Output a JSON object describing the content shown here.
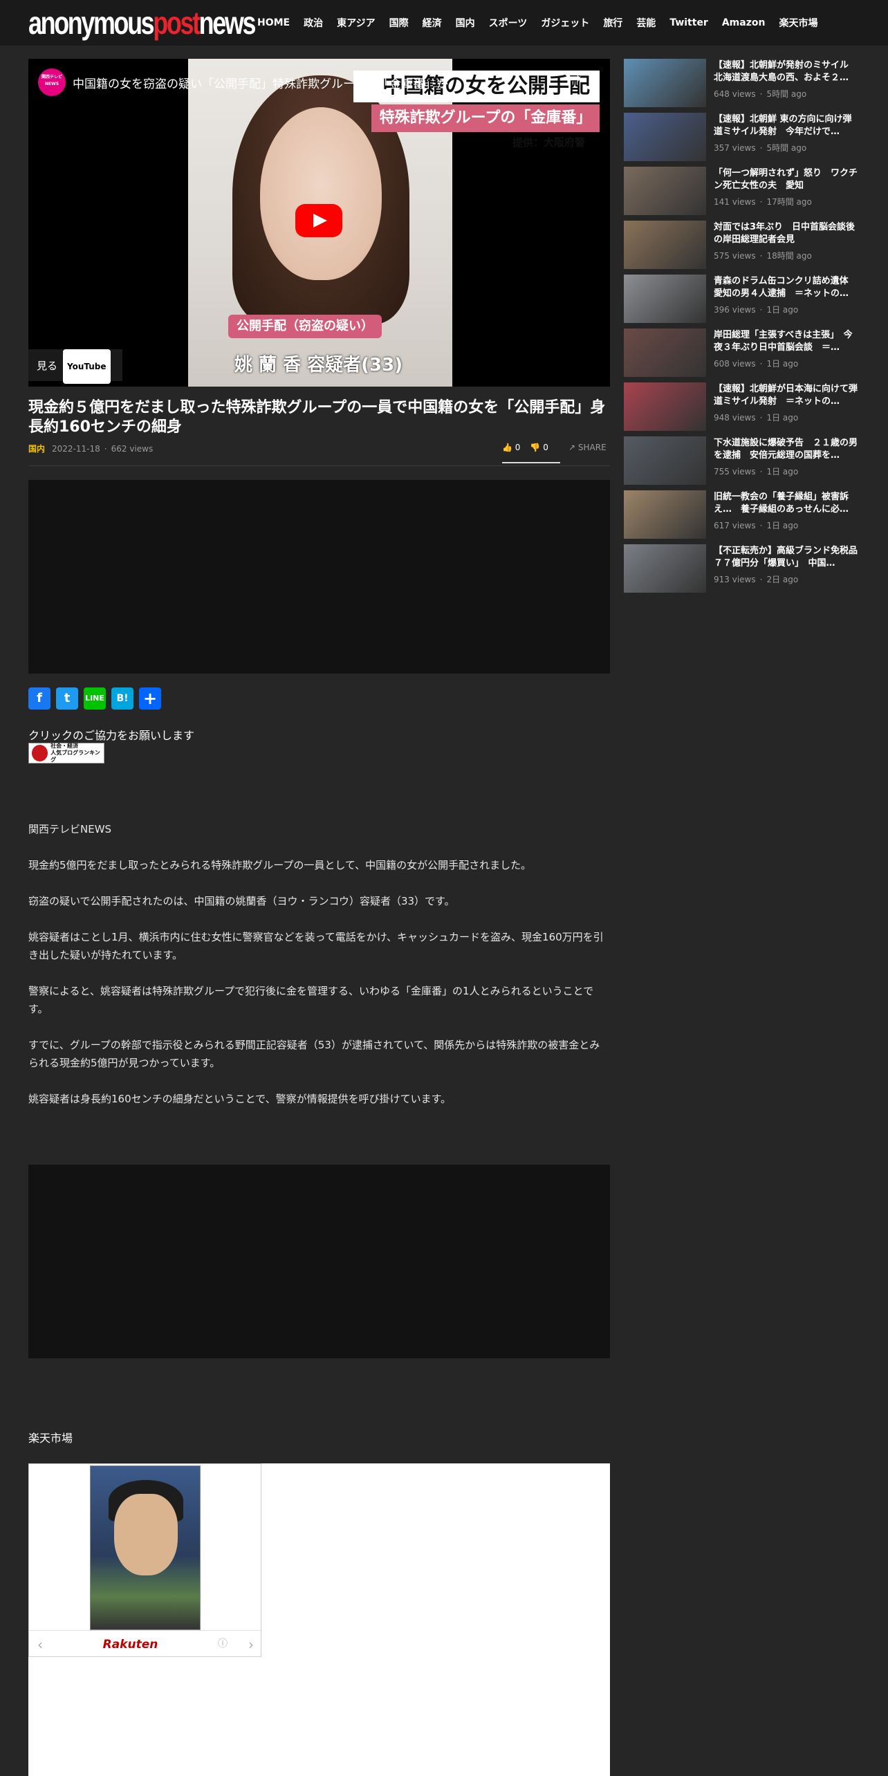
{
  "header": {
    "logo_anonymous": "anonymous",
    "logo_post": "post",
    "logo_news": "news",
    "nav": [
      "HOME",
      "政治",
      "東アジア",
      "国際",
      "経済",
      "国内",
      "スポーツ",
      "ガジェット",
      "旅行",
      "芸能",
      "Twitter",
      "Amazon",
      "楽天市場"
    ]
  },
  "video": {
    "channel_logo": "関西テレビ NEWS",
    "title": "中国籍の女を窃盗の疑い「公開手配」特殊詐欺グループの「金庫番」か",
    "banner_main": "中国籍の女を公開手配",
    "banner_sub": "特殊詐欺グループの「金庫番」",
    "credit": "提供：大阪府警",
    "caption_tag": "公開手配（窃盗の疑い）",
    "caption_name": "姚 蘭 香 容疑者(33)",
    "watch_label": "見る",
    "youtube_label": "YouTube",
    "play_icon": "youtube-play-icon",
    "share_icon": "share-arrow-icon"
  },
  "article": {
    "title": "現金約５億円をだまし取った特殊詐欺グループの一員で中国籍の女を「公開手配」身長約160センチの細身",
    "category": "国内",
    "date": "2022-11-18",
    "views": "662 views",
    "likes": "0",
    "dislikes": "0",
    "share_label": "SHARE",
    "click_text": "クリックのご協力をお願いします",
    "blog_rank_line1": "社会・経済",
    "blog_rank_line2": "人気ブログランキング",
    "paragraphs": [
      "関西テレビNEWS",
      "現金約5億円をだまし取ったとみられる特殊詐欺グループの一員として、中国籍の女が公開手配されました。",
      "窃盗の疑いで公開手配されたのは、中国籍の姚蘭香（ヨウ・ランコウ）容疑者（33）です。",
      "姚容疑者はことし1月、横浜市内に住む女性に警察官などを装って電話をかけ、キャッシュカードを盗み、現金160万円を引き出した疑いが持たれています。",
      "警察によると、姚容疑者は特殊詐欺グループで犯行後に金を管理する、いわゆる「金庫番」の1人とみられるということです。",
      "すでに、グループの幹部で指示役とみられる野間正記容疑者（53）が逮捕されていて、関係先からは特殊詐欺の被害金とみられる現金約5億円が見つかっています。",
      "姚容疑者は身長約160センチの細身だということで、警察が情報提供を呼び掛けています。"
    ],
    "rakuten_heading": "楽天市場",
    "rakuten_logo": "Rakuten"
  },
  "social": [
    "facebook-icon",
    "twitter-icon",
    "line-icon",
    "hatena-icon",
    "addtoany-icon"
  ],
  "sidebar": [
    {
      "title": "【速報】北朝鮮が発射のミサイル　北海道渡島大島の西、およそ２…",
      "views": "648 views",
      "ago": "5時間 ago",
      "thumb": "#5f8fb3"
    },
    {
      "title": "【速報】北朝鮮 東の方向に向け弾道ミサイル発射　今年だけで…",
      "views": "357 views",
      "ago": "5時間 ago",
      "thumb": "#4a5f8c"
    },
    {
      "title": "「何一つ解明されず」怒り　ワクチン死亡女性の夫　愛知",
      "views": "141 views",
      "ago": "17時間 ago",
      "thumb": "#7a6a5c"
    },
    {
      "title": "対面では3年ぶり　日中首脳会談後の岸田総理記者会見",
      "views": "575 views",
      "ago": "18時間 ago",
      "thumb": "#8a7258"
    },
    {
      "title": "青森のドラム缶コンクリ詰め遺体　愛知の男４人逮捕　＝ネットの…",
      "views": "396 views",
      "ago": "1日 ago",
      "thumb": "#8c8f94"
    },
    {
      "title": "岸田総理「主張すべきは主張」　今夜３年ぶり日中首脳会談　＝…",
      "views": "608 views",
      "ago": "1日 ago",
      "thumb": "#6b4a46"
    },
    {
      "title": "【速報】北朝鮮が日本海に向けて弾道ミサイル発射　＝ネットの…",
      "views": "948 views",
      "ago": "1日 ago",
      "thumb": "#a8434f"
    },
    {
      "title": "下水道施設に爆破予告　２１歳の男を逮捕　安倍元総理の国葬を…",
      "views": "755 views",
      "ago": "1日 ago",
      "thumb": "#555b63"
    },
    {
      "title": "旧統一教会の「養子縁組」被害訴え…　養子縁組のあっせんに必…",
      "views": "617 views",
      "ago": "1日 ago",
      "thumb": "#9c8468"
    },
    {
      "title": "【不正転売か】高級ブランド免税品７７億円分「爆買い」　中国…",
      "views": "913 views",
      "ago": "2日 ago",
      "thumb": "#7b7f86"
    }
  ],
  "colors": {
    "accent_red": "#e8242c",
    "category_yellow": "#f3c300",
    "background": "#262626",
    "header": "#1a1a1a"
  }
}
